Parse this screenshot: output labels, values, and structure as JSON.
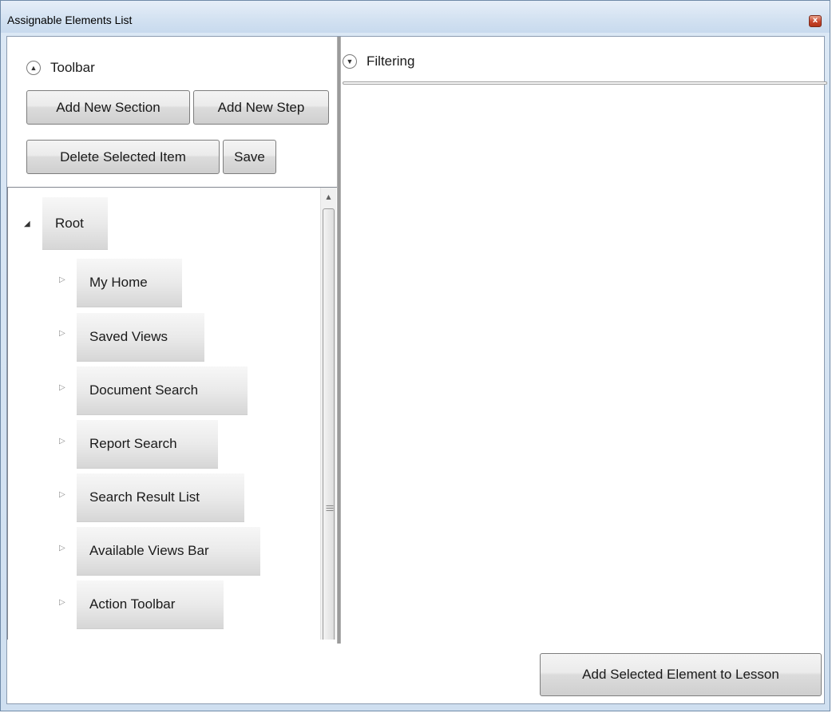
{
  "window": {
    "title": "Assignable Elements List",
    "close_glyph": "x"
  },
  "toolbar": {
    "header": "Toolbar",
    "add_section": "Add New Section",
    "add_step": "Add New Step",
    "delete_item": "Delete Selected Item",
    "save": "Save"
  },
  "tree": {
    "root": "Root",
    "children": [
      "My Home",
      "Saved Views",
      "Document Search",
      "Report Search",
      "Search Result List",
      "Available Views Bar",
      "Action Toolbar"
    ]
  },
  "filtering": {
    "header": "Filtering"
  },
  "footer": {
    "add_to_lesson": "Add Selected Element to Lesson"
  }
}
